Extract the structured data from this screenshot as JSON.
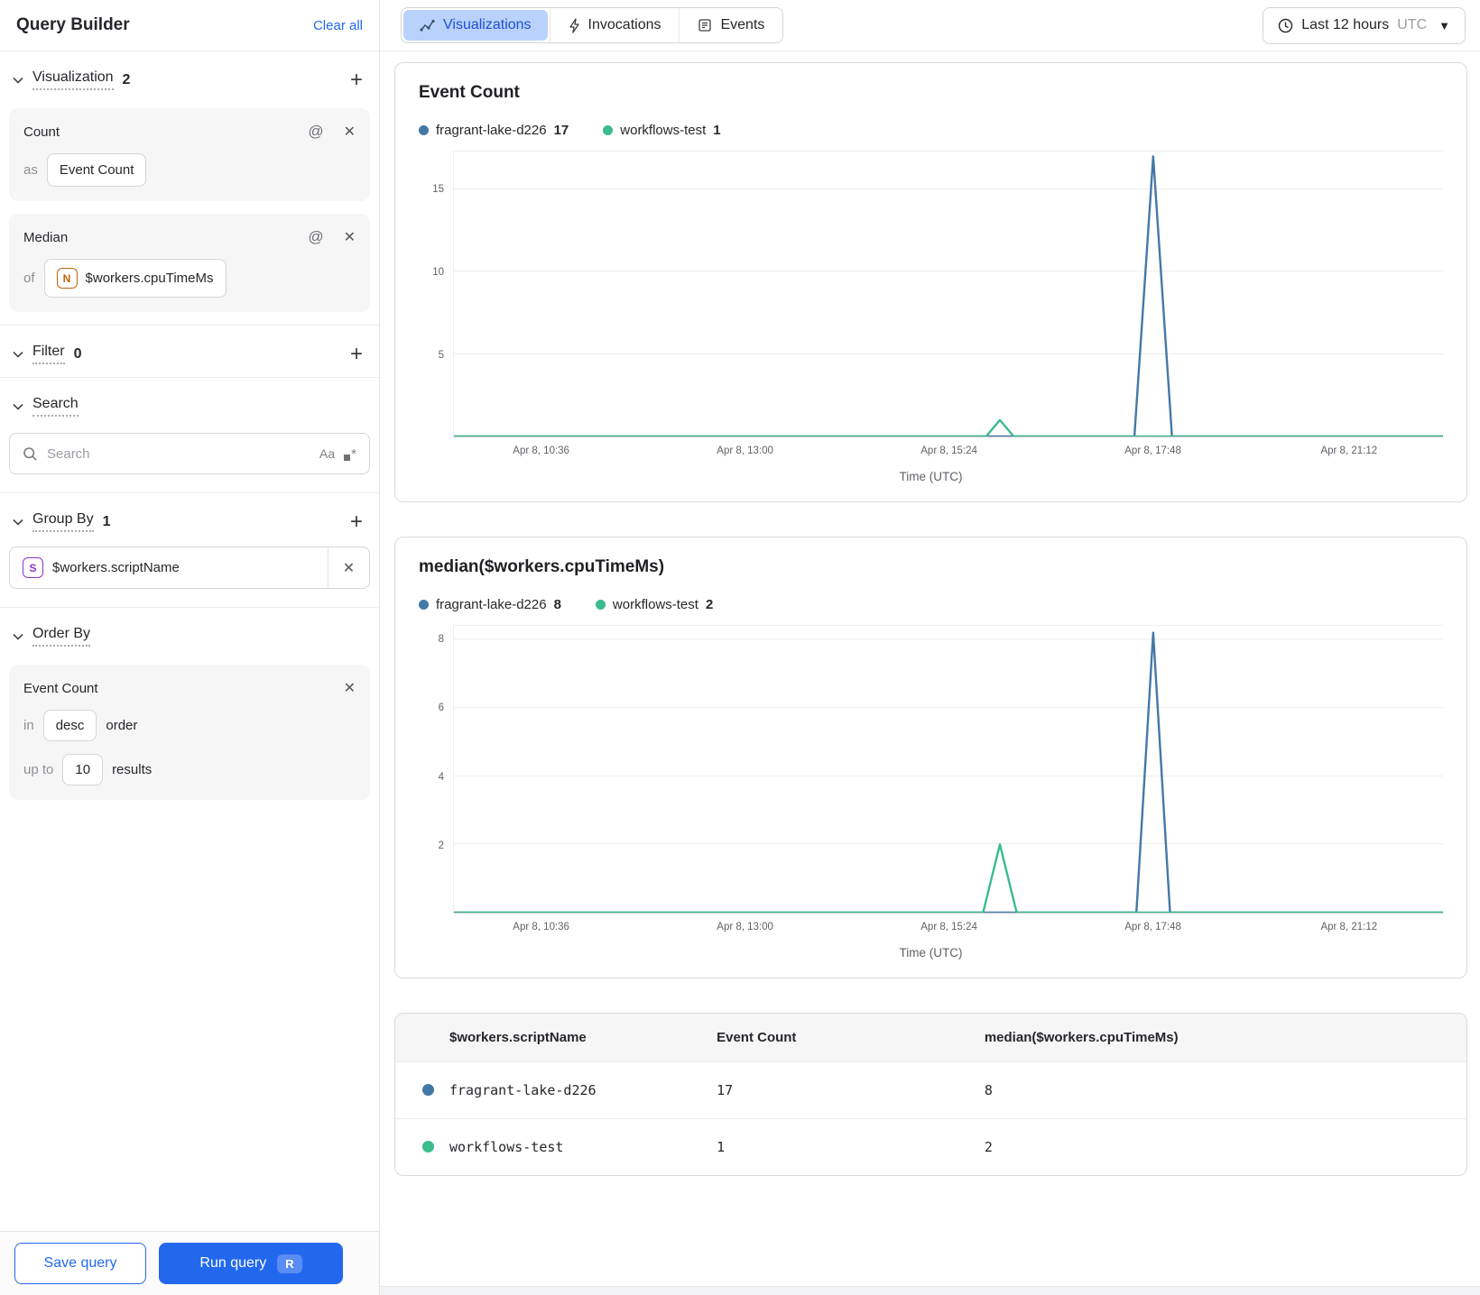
{
  "sidebar": {
    "title": "Query Builder",
    "clear_all": "Clear all",
    "visualization": {
      "label": "Visualization",
      "count": "2"
    },
    "count_card": {
      "title": "Count",
      "as_label": "as",
      "value": "Event Count"
    },
    "median_card": {
      "title": "Median",
      "of_label": "of",
      "badge": "N",
      "value": "$workers.cpuTimeMs"
    },
    "filter": {
      "label": "Filter",
      "count": "0"
    },
    "search": {
      "label": "Search",
      "placeholder": "Search",
      "match_case": "Aa"
    },
    "group_by": {
      "label": "Group By",
      "count": "1",
      "badge": "S",
      "value": "$workers.scriptName"
    },
    "order_by": {
      "label": "Order By",
      "field": "Event Count",
      "in_label": "in",
      "direction": "desc",
      "order_label": "order",
      "up_to_label": "up to",
      "limit": "10",
      "results_label": "results"
    },
    "save_button": "Save query",
    "run_button": "Run query",
    "run_shortcut": "R"
  },
  "topbar": {
    "tabs": [
      {
        "label": "Visualizations",
        "active": true
      },
      {
        "label": "Invocations",
        "active": false
      },
      {
        "label": "Events",
        "active": false
      }
    ],
    "time_range": {
      "label": "Last 12 hours",
      "timezone": "UTC"
    }
  },
  "colors": {
    "blue_series": "#4478a8",
    "green_series": "#3abc8d",
    "accent_blue": "#2268ef",
    "active_tab_bg": "#b9d2fb"
  },
  "chart_data": [
    {
      "type": "line",
      "title": "Event Count",
      "xlabel": "Time (UTC)",
      "ylim": [
        0,
        17.3
      ],
      "yticks": [
        5,
        10,
        15
      ],
      "grid": true,
      "legend_position": "top",
      "xticks": [
        {
          "label": "Apr 8, 10:36",
          "pos": 0.089
        },
        {
          "label": "Apr 8, 13:00",
          "pos": 0.295
        },
        {
          "label": "Apr 8, 15:24",
          "pos": 0.501
        },
        {
          "label": "Apr 8, 17:48",
          "pos": 0.707
        },
        {
          "label": "Apr 8, 21:12",
          "pos": 0.905
        }
      ],
      "series": [
        {
          "name": "fragrant-lake-d226",
          "legend_value": "17",
          "color": "#4478a8",
          "points": [
            [
              0,
              0
            ],
            [
              0.688,
              0
            ],
            [
              0.707,
              17
            ],
            [
              0.726,
              0
            ],
            [
              1,
              0
            ]
          ]
        },
        {
          "name": "workflows-test",
          "legend_value": "1",
          "color": "#3abc8d",
          "points": [
            [
              0,
              0
            ],
            [
              0.538,
              0
            ],
            [
              0.552,
              1
            ],
            [
              0.566,
              0
            ],
            [
              1,
              0
            ]
          ]
        }
      ]
    },
    {
      "type": "line",
      "title": "median($workers.cpuTimeMs)",
      "xlabel": "Time (UTC)",
      "ylim": [
        0,
        8.4
      ],
      "yticks": [
        2,
        4,
        6,
        8
      ],
      "grid": true,
      "legend_position": "top",
      "xticks": [
        {
          "label": "Apr 8, 10:36",
          "pos": 0.089
        },
        {
          "label": "Apr 8, 13:00",
          "pos": 0.295
        },
        {
          "label": "Apr 8, 15:24",
          "pos": 0.501
        },
        {
          "label": "Apr 8, 17:48",
          "pos": 0.707
        },
        {
          "label": "Apr 8, 21:12",
          "pos": 0.905
        }
      ],
      "series": [
        {
          "name": "fragrant-lake-d226",
          "legend_value": "8",
          "color": "#4478a8",
          "points": [
            [
              0,
              0
            ],
            [
              0.69,
              0
            ],
            [
              0.707,
              8.2
            ],
            [
              0.724,
              0
            ],
            [
              1,
              0
            ]
          ]
        },
        {
          "name": "workflows-test",
          "legend_value": "2",
          "color": "#3abc8d",
          "points": [
            [
              0,
              0
            ],
            [
              0.535,
              0
            ],
            [
              0.552,
              2
            ],
            [
              0.569,
              0
            ],
            [
              1,
              0
            ]
          ]
        }
      ]
    }
  ],
  "table": {
    "columns": [
      "$workers.scriptName",
      "Event Count",
      "median($workers.cpuTimeMs)"
    ],
    "rows": [
      {
        "color": "#4478a8",
        "name": "fragrant-lake-d226",
        "event_count": "17",
        "median": "8"
      },
      {
        "color": "#3abc8d",
        "name": "workflows-test",
        "event_count": "1",
        "median": "2"
      }
    ]
  }
}
